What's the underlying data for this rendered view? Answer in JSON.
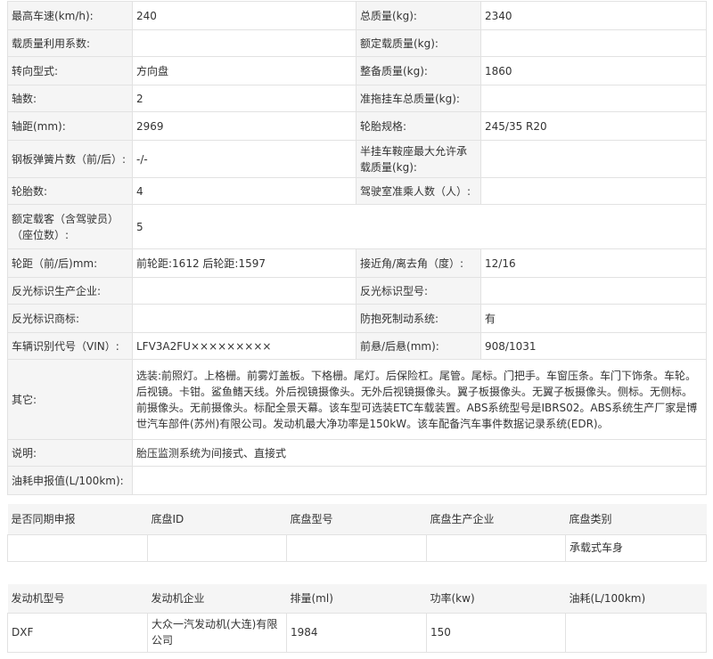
{
  "spec": {
    "rows": [
      {
        "l1": "最高车速(km/h):",
        "v1": "240",
        "l2": "总质量(kg):",
        "v2": "2340"
      },
      {
        "l1": "载质量利用系数:",
        "v1": "",
        "l2": "额定载质量(kg):",
        "v2": ""
      },
      {
        "l1": "转向型式:",
        "v1": "方向盘",
        "l2": "整备质量(kg):",
        "v2": "1860"
      },
      {
        "l1": "轴数:",
        "v1": "2",
        "l2": "准拖挂车总质量(kg):",
        "v2": ""
      },
      {
        "l1": "轴距(mm):",
        "v1": "2969",
        "l2": "轮胎规格:",
        "v2": "245/35 R20"
      },
      {
        "l1": "钢板弹簧片数（前/后）:",
        "v1": "-/-",
        "l2": "半挂车鞍座最大允许承载质量(kg):",
        "v2": ""
      },
      {
        "l1": "轮胎数:",
        "v1": "4",
        "l2": "驾驶室准乘人数（人）:",
        "v2": ""
      },
      {
        "l1": "额定载客（含驾驶员）（座位数）:",
        "v1": "5"
      },
      {
        "l1": "轮距（前/后)mm:",
        "v1": "前轮距:1612 后轮距:1597",
        "l2": "接近角/离去角（度）:",
        "v2": "12/16"
      },
      {
        "l1": "反光标识生产企业:",
        "v1": "",
        "l2": "反光标识型号:",
        "v2": ""
      },
      {
        "l1": "反光标识商标:",
        "v1": "",
        "l2": "防抱死制动系统:",
        "v2": "有"
      },
      {
        "l1": "车辆识别代号（VIN）:",
        "v1": "LFV3A2FU×××××××××",
        "l2": "前悬/后悬(mm):",
        "v2": "908/1031"
      }
    ],
    "other_label": "其它:",
    "other_value": "选装:前照灯。上格栅。前雾灯盖板。下格栅。尾灯。后保险杠。尾管。尾标。门把手。车窗压条。车门下饰条。车轮。后视镜。卡钳。鲨鱼鳍天线。外后视镜摄像头。无外后视镜摄像头。翼子板摄像头。无翼子板摄像头。侧标。无侧标。前摄像头。无前摄像头。标配全景天幕。该车型可选装ETC车载装置。ABS系统型号是IBRS02。ABS系统生产厂家是博世汽车部件(苏州)有限公司。发动机最大净功率是150kW。该车配备汽车事件数据记录系统(EDR)。",
    "note_label": "说明:",
    "note_value": "胎压监测系统为间接式、直接式",
    "fuel_label": "油耗申报值(L/100km):",
    "fuel_value": ""
  },
  "chassis": {
    "headers": [
      "是否同期申报",
      "底盘ID",
      "底盘型号",
      "底盘生产企业",
      "底盘类别"
    ],
    "row": [
      "",
      "",
      "",
      "",
      "承载式车身"
    ]
  },
  "engine": {
    "headers": [
      "发动机型号",
      "发动机企业",
      "排量(ml)",
      "功率(kw)",
      "油耗(L/100km)"
    ],
    "row": [
      "DXF",
      "大众一汽发动机(大连)有限公司",
      "1984",
      "150",
      ""
    ]
  }
}
